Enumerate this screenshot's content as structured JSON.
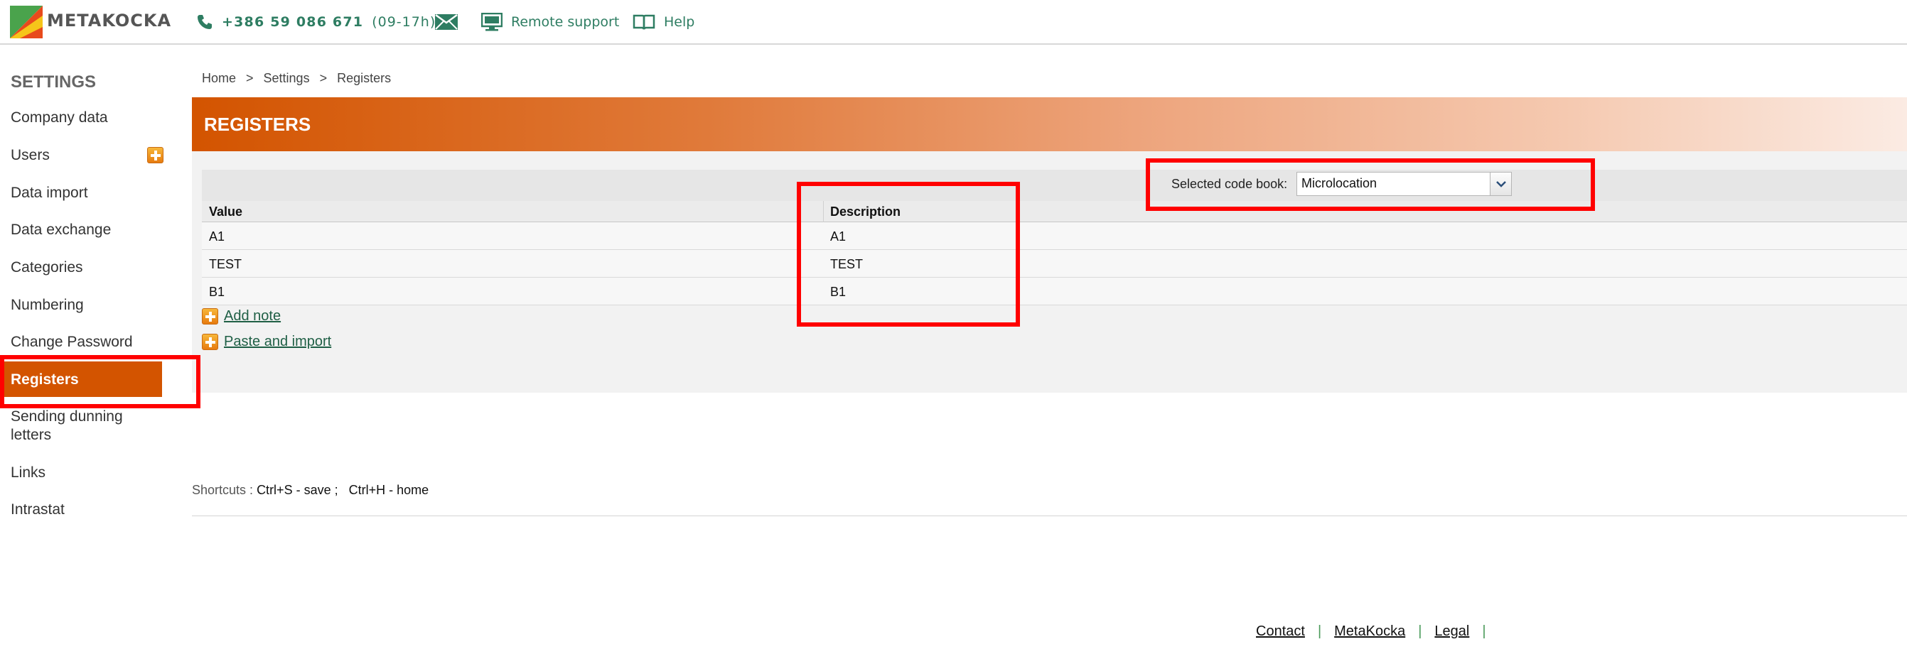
{
  "header": {
    "logo_text": "METAKOCKA",
    "phone_number": "+386 59 086 671",
    "phone_hours": "(09-17h)",
    "remote_support": "Remote support",
    "help": "Help"
  },
  "sidebar": {
    "title": "SETTINGS",
    "items": [
      {
        "label": "Company data"
      },
      {
        "label": "Users"
      },
      {
        "label": "Data import"
      },
      {
        "label": "Data exchange"
      },
      {
        "label": "Categories"
      },
      {
        "label": "Numbering"
      },
      {
        "label": "Change Password"
      },
      {
        "label": "Registers"
      },
      {
        "label": "Sending dunning letters"
      },
      {
        "label": "Links"
      },
      {
        "label": "Intrastat"
      }
    ]
  },
  "breadcrumb": [
    "Home",
    "Settings",
    "Registers"
  ],
  "breadcrumb_separator": ">",
  "page": {
    "title": "REGISTERS",
    "codebook_label": "Selected code book:",
    "codebook_value": "Microlocation"
  },
  "table": {
    "columns": [
      "Value",
      "Description"
    ],
    "rows": [
      [
        "A1",
        "A1"
      ],
      [
        "TEST",
        "TEST"
      ],
      [
        "B1",
        "B1"
      ]
    ]
  },
  "actions": {
    "add_note": "Add note",
    "paste_import": "Paste and import"
  },
  "shortcuts": {
    "label": "Shortcuts :",
    "keys": "Ctrl+S - save ;   Ctrl+H - home"
  },
  "footer": {
    "links": [
      "Contact",
      "MetaKocka",
      "Legal"
    ],
    "separator": "|"
  },
  "colors": {
    "accent": "#d35400",
    "link_green": "#2e7d62",
    "highlight": "#ff0000"
  },
  "icons": [
    "logo-icon",
    "phone-icon",
    "mail-icon",
    "monitor-icon",
    "book-icon",
    "plus-icon",
    "chevron-down-icon"
  ]
}
